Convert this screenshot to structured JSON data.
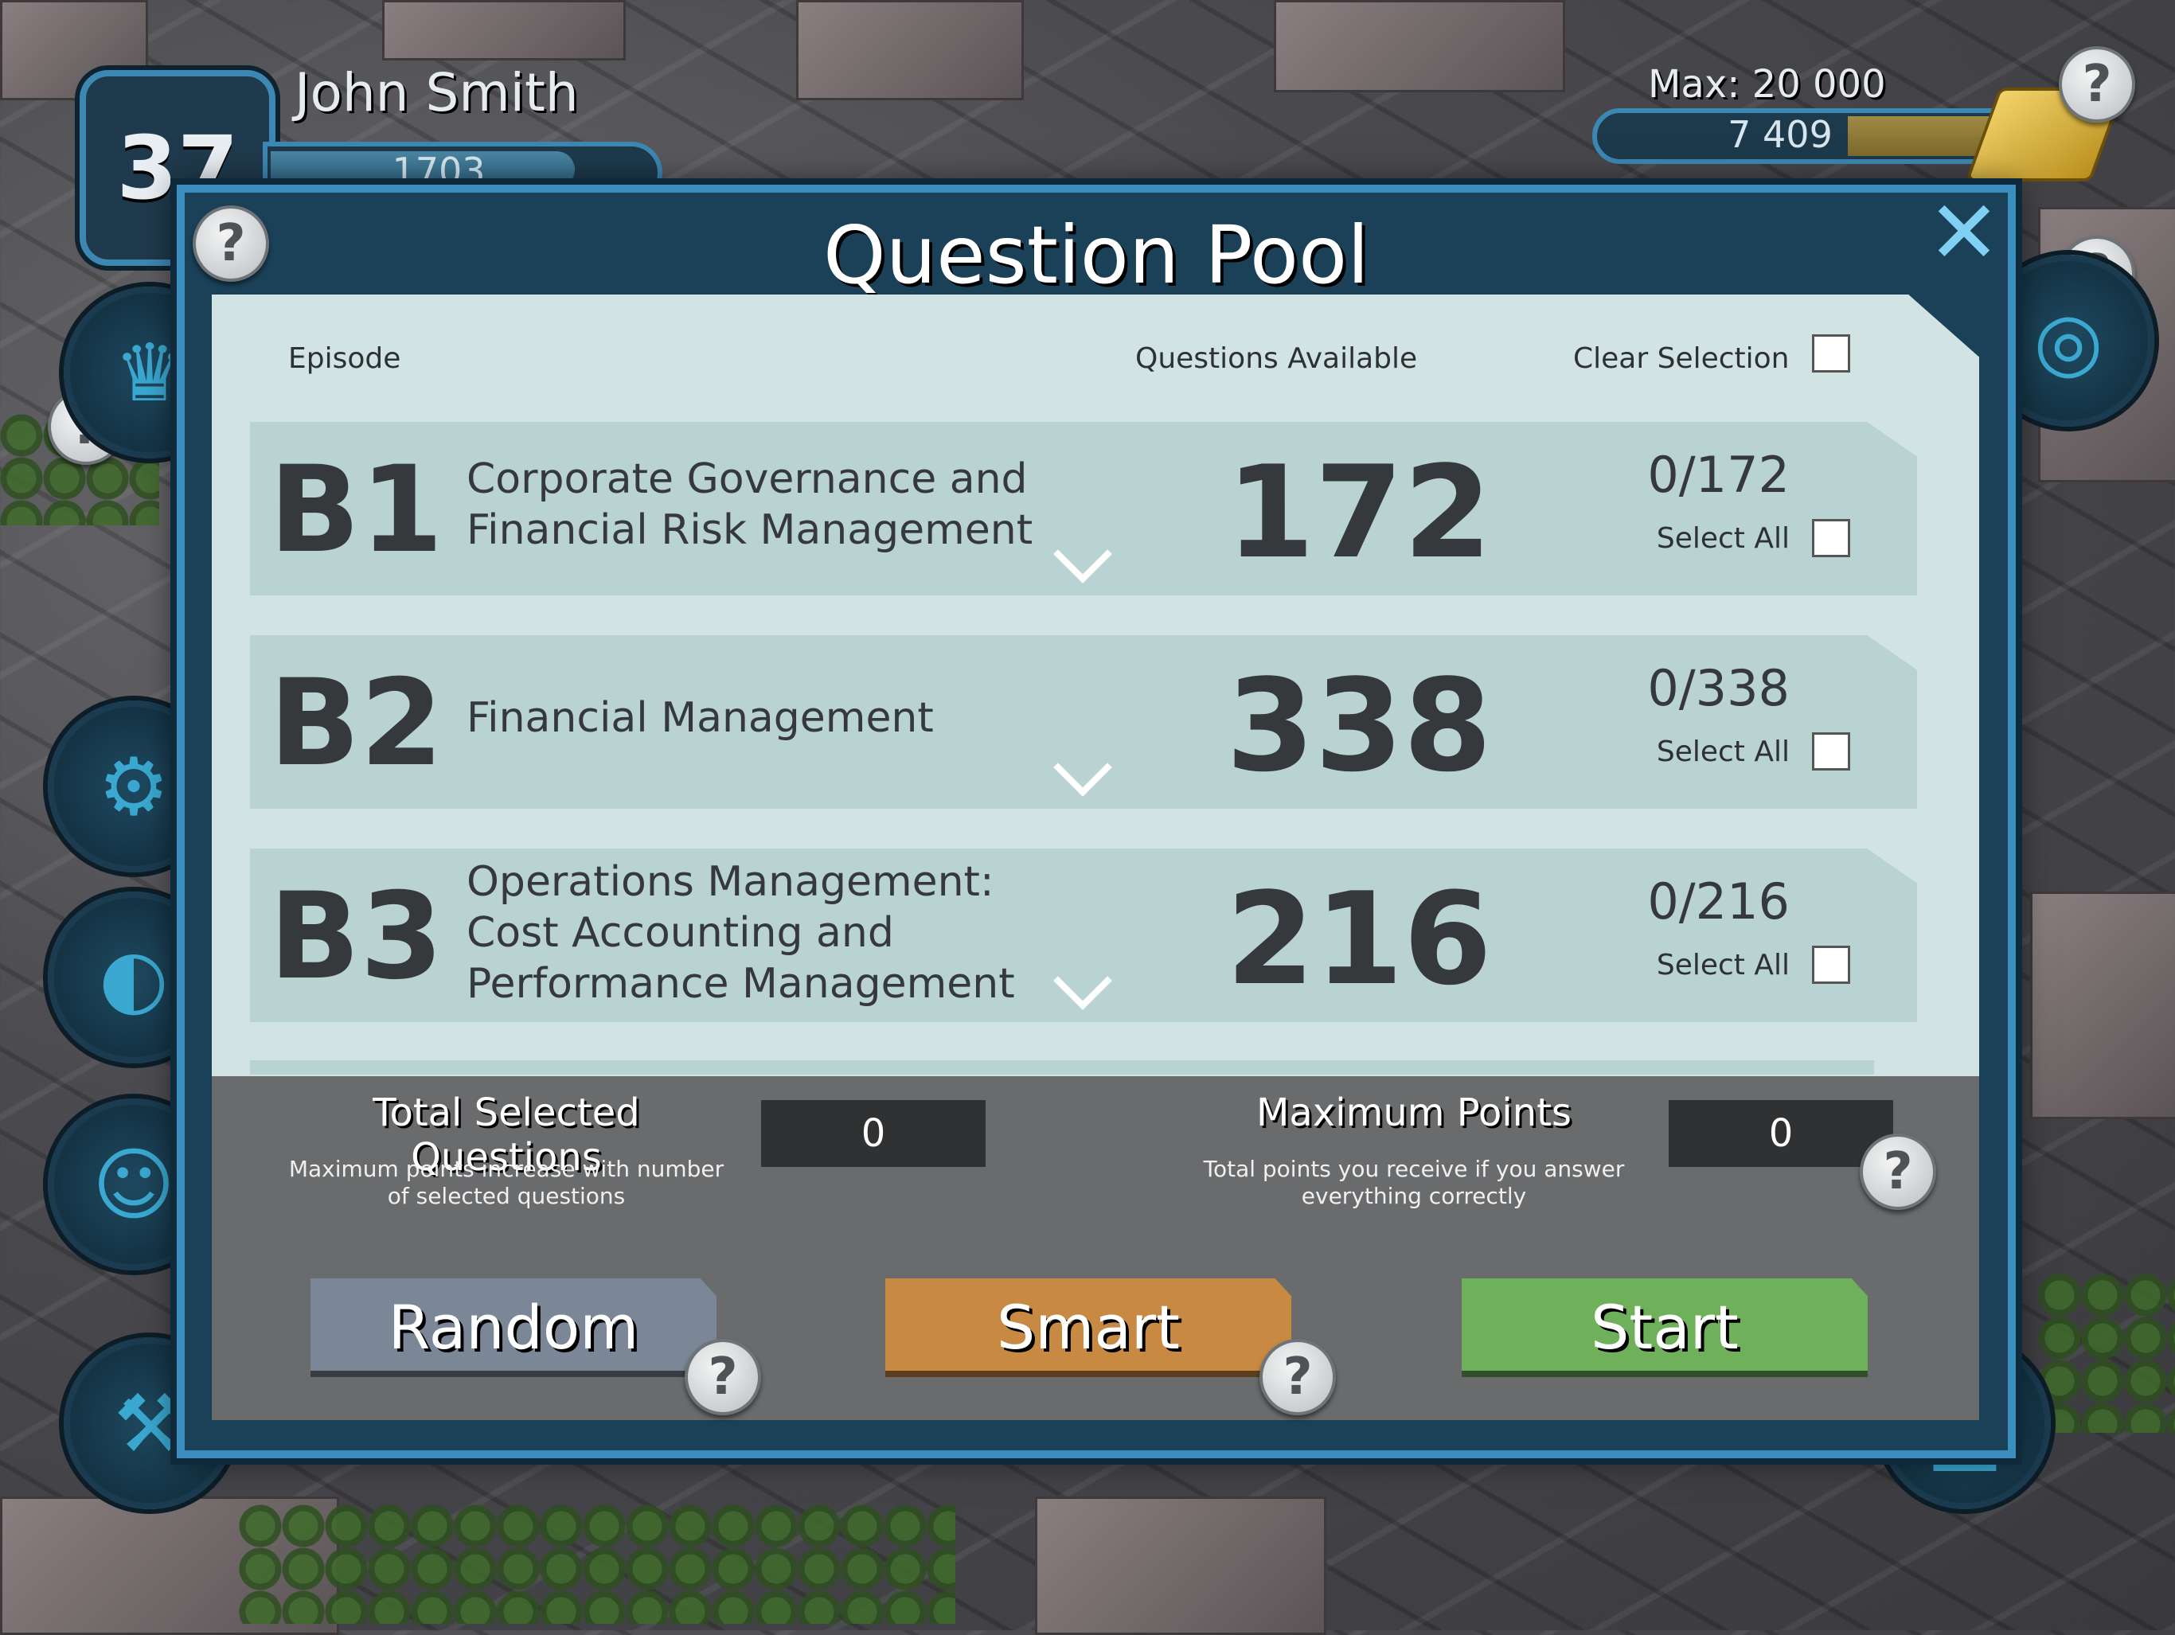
{
  "hud": {
    "level": "37",
    "player_name": "John Smith",
    "xp_value": "1703",
    "currency_max": "Max: 20 000",
    "currency_value": "7 409",
    "currency_fill": 0.37
  },
  "dialog": {
    "title": "Question Pool",
    "headers": {
      "episode": "Episode",
      "questions_available": "Questions Available",
      "clear_selection": "Clear Selection"
    },
    "rows": [
      {
        "code": "B1",
        "name": "Corporate Governance and Financial Risk Management",
        "available": "172",
        "selected": "0/172",
        "select_all": "Select All"
      },
      {
        "code": "B2",
        "name": "Financial Management",
        "available": "338",
        "selected": "0/338",
        "select_all": "Select All"
      },
      {
        "code": "B3",
        "name": "Operations Management: Cost Accounting and Performance Management",
        "available": "216",
        "selected": "0/216",
        "select_all": "Select All"
      }
    ],
    "summary": {
      "total_label": "Total Selected Questions",
      "total_sub": "Maximum points increase with number of selected questions",
      "total_value": "0",
      "max_label": "Maximum Points",
      "max_sub": "Total points you receive if you answer everything correctly",
      "max_value": "0"
    },
    "buttons": {
      "random": "Random",
      "smart": "Smart",
      "start": "Start"
    },
    "help_glyph": "?",
    "close_glyph": "✕"
  }
}
